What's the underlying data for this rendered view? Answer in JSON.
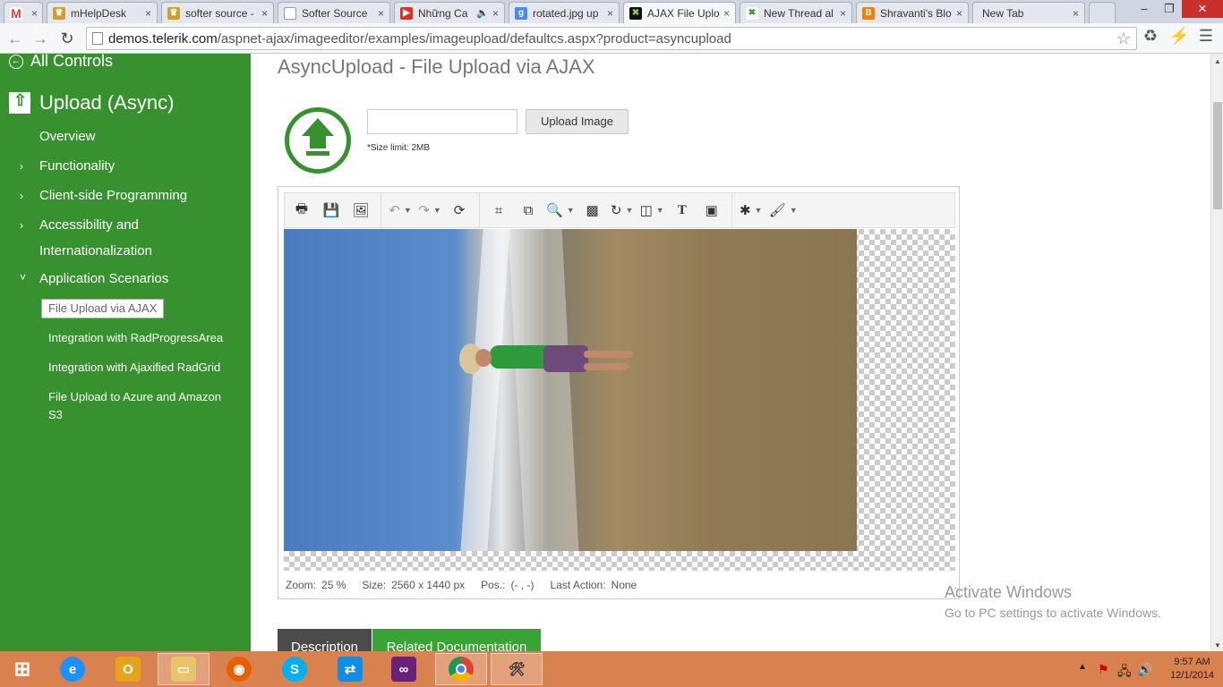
{
  "browser": {
    "tabs": [
      {
        "label": "",
        "icon": "gmail-icon",
        "left": 0
      },
      {
        "label": "mHelpDesk",
        "icon": "crown-icon"
      },
      {
        "label": "softer source -",
        "icon": "crown-icon"
      },
      {
        "label": "Softer Source",
        "icon": "page-icon"
      },
      {
        "label": "Những Ca",
        "icon": "youtube-icon"
      },
      {
        "label": "rotated.jpg up",
        "icon": "google-icon"
      },
      {
        "label": "AJAX File Uplo",
        "icon": "telerik-icon"
      },
      {
        "label": "New Thread al",
        "icon": "telerik-icon"
      },
      {
        "label": "Shravanti's Blo",
        "icon": "blogger-icon"
      },
      {
        "label": "New Tab",
        "icon": ""
      }
    ],
    "url_host": "demos.telerik.com",
    "url_path": "/aspnet-ajax/imageeditor/examples/imageupload/defaultcs.aspx?product=asyncupload"
  },
  "sidebar": {
    "all_controls": "All Controls",
    "title": "Upload (Async)",
    "items": [
      {
        "label": "Overview"
      },
      {
        "label": "Functionality"
      },
      {
        "label": "Client-side Programming"
      },
      {
        "label": "Accessibility and"
      },
      {
        "label": "Internationalization"
      },
      {
        "label": "Application Scenarios"
      }
    ],
    "subitems": [
      {
        "label": "File Upload via AJAX"
      },
      {
        "label": "Integration with RadProgressArea"
      },
      {
        "label": "Integration with Ajaxified RadGrid"
      },
      {
        "label": "File Upload to Azure and Amazon S3"
      }
    ]
  },
  "main": {
    "title": "AsyncUpload - File Upload via AJAX",
    "upload_button": "Upload Image",
    "size_limit": "*Size limit: 2MB",
    "file_input_value": ""
  },
  "editor": {
    "status": {
      "zoom_label": "Zoom:",
      "zoom_value": "25 %",
      "size_label": "Size:",
      "size_value": "2560 x 1440 px",
      "pos_label": "Pos.:",
      "pos_value": "(- , -)",
      "action_label": "Last Action:",
      "action_value": "None"
    }
  },
  "bottom_tabs": {
    "description": "Description",
    "related": "Related Documentation"
  },
  "watermark": {
    "line1": "Activate Windows",
    "line2": "Go to PC settings to activate Windows."
  },
  "taskbar": {
    "time": "9:57 AM",
    "date": "12/1/2014"
  },
  "colors": {
    "sidebar_green": "#37912f",
    "accent_green": "#37a433",
    "taskbar_orange": "#d9824f"
  }
}
